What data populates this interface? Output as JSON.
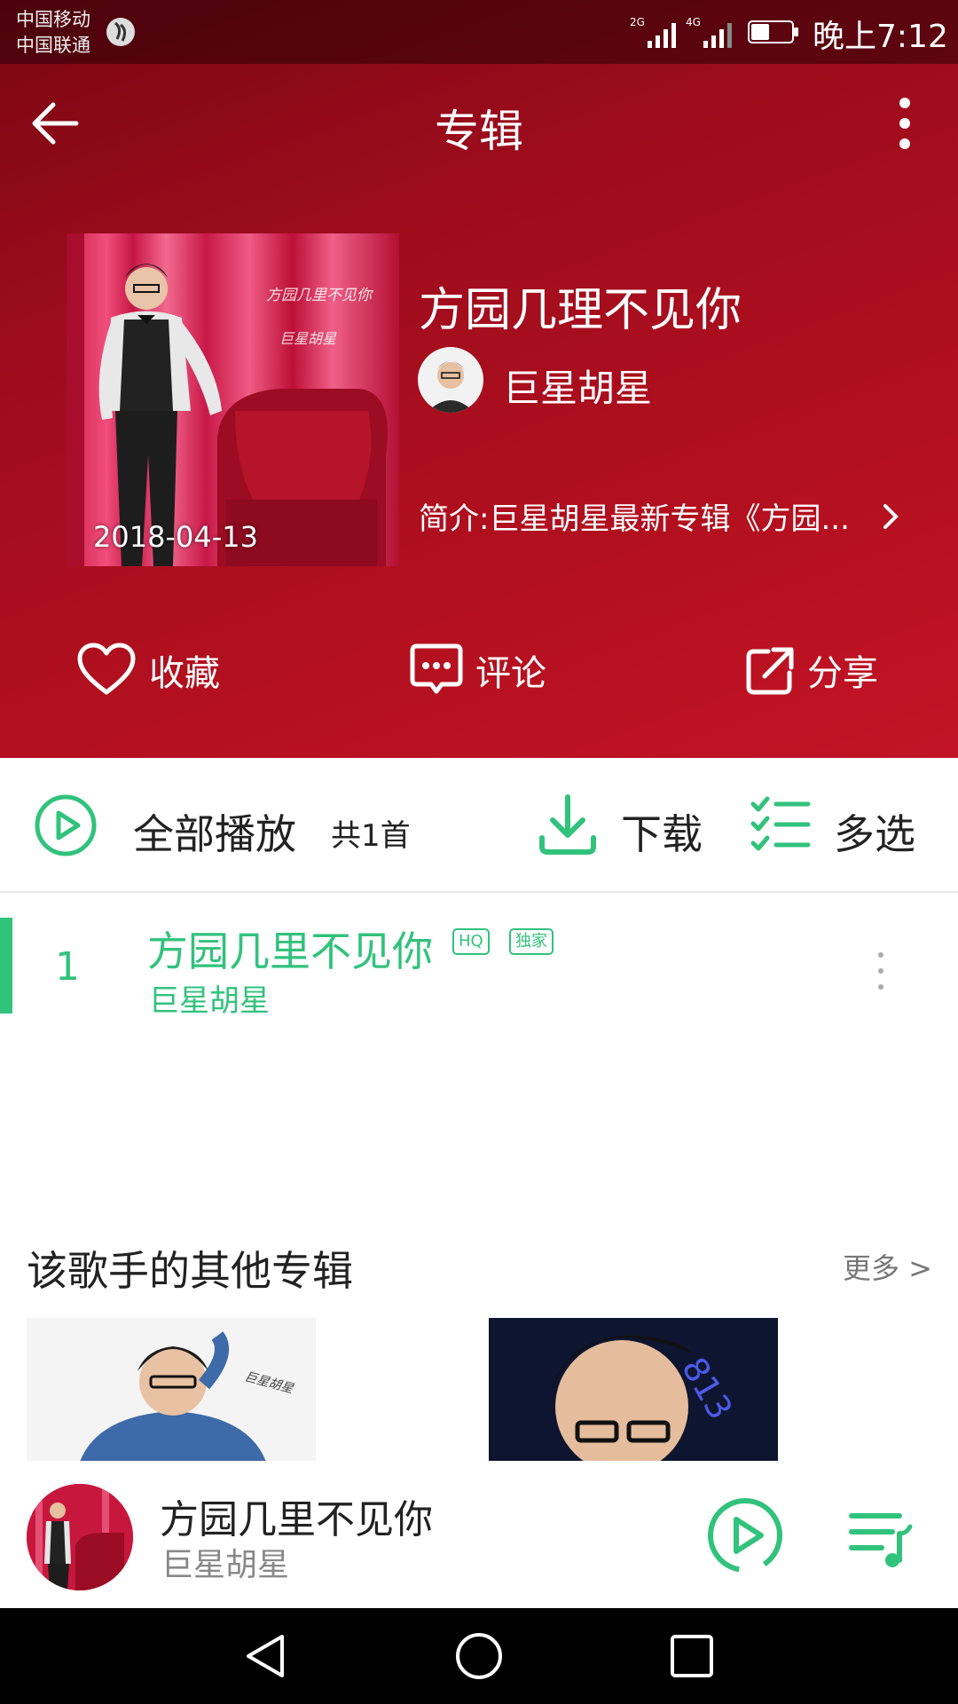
{
  "status_bar": {
    "carrier_1": "中国移动",
    "carrier_2": "中国联通",
    "signal_1": "2G",
    "signal_2": "4G",
    "time": "晚上7:12"
  },
  "topbar": {
    "title": "专辑",
    "back_icon": "arrow-left-icon",
    "more_icon": "more-vertical-icon"
  },
  "album": {
    "title": "方园几理不见你",
    "artist": "巨星胡星",
    "release_date": "2018-04-13",
    "cover_text_1": "方园几里不见你",
    "cover_text_2": "巨星胡星",
    "intro": "简介:巨星胡星最新专辑《方园...",
    "actions": [
      {
        "label": "收藏",
        "icon": "heart-icon"
      },
      {
        "label": "评论",
        "icon": "comment-icon"
      },
      {
        "label": "分享",
        "icon": "share-icon"
      }
    ]
  },
  "toolbar": {
    "play_all": "全部播放",
    "count": "共1首",
    "download": "下载",
    "multi_select": "多选"
  },
  "songs": [
    {
      "index": "1",
      "title": "方园几里不见你",
      "artist": "巨星胡星",
      "badges": [
        "HQ",
        "独家"
      ]
    }
  ],
  "other_albums": {
    "title": "该歌手的其他专辑",
    "more": "更多 >",
    "cover_text_1": "巨星胡星",
    "cover_text_2": "813"
  },
  "mini_player": {
    "title": "方园几里不见你",
    "artist": "巨星胡星"
  },
  "colors": {
    "accent": "#31c27c",
    "header_red": "#b3101f"
  }
}
